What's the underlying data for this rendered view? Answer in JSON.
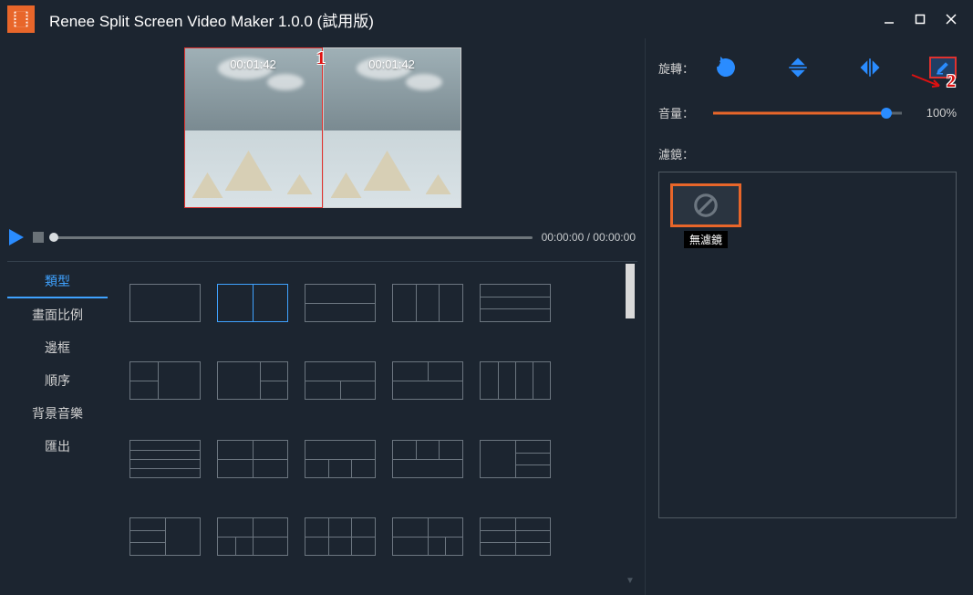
{
  "app": {
    "title": "Renee Split Screen Video Maker 1.0.0 (試用版)"
  },
  "preview": {
    "clip1_time": "00:01:42",
    "clip2_time": "00:01:42"
  },
  "player": {
    "timecode": "00:00:00 / 00:00:00"
  },
  "tabs": {
    "items": [
      "類型",
      "畫面比例",
      "邊框",
      "順序",
      "背景音樂",
      "匯出"
    ],
    "active_index": 0
  },
  "right": {
    "rotate_label": "旋轉：",
    "volume_label": "音量：",
    "volume_value": "100%",
    "filter_label": "濾鏡：",
    "filter_items": [
      {
        "name": "無濾鏡"
      }
    ]
  },
  "callouts": {
    "c1": "1",
    "c2": "2"
  },
  "colors": {
    "accent_blue": "#2a8cff",
    "accent_orange": "#e8662a",
    "danger_red": "#e0322f"
  }
}
